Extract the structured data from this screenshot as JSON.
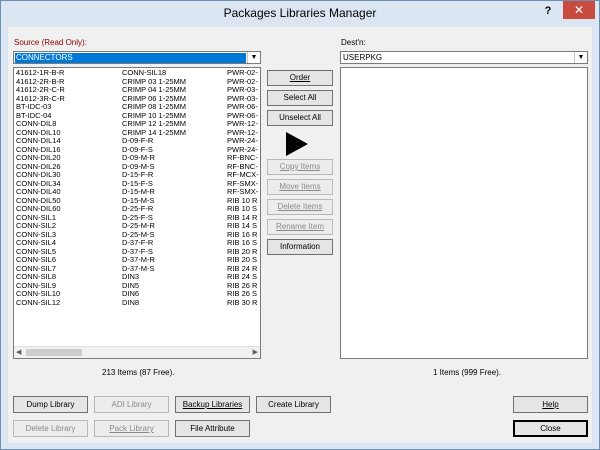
{
  "window": {
    "title": "Packages Libraries Manager",
    "help": "?",
    "close": "✕"
  },
  "source": {
    "label": "Source (Read Only):",
    "selected": "CONNECTORS"
  },
  "dest": {
    "label": "Dest'n:",
    "selected": "USERPKG"
  },
  "source_list": {
    "col1": [
      "41612-1R-B-R",
      "41612-2R-B-R",
      "41612-2R-C-R",
      "41612-3R-C-R",
      "BT-IDC-03",
      "BT-IDC-04",
      "CONN-DIL8",
      "CONN-DIL10",
      "CONN-DIL14",
      "CONN-DIL16",
      "CONN-DIL20",
      "CONN-DIL26",
      "CONN-DIL30",
      "CONN-DIL34",
      "CONN-DIL40",
      "CONN-DIL50",
      "CONN-DIL60",
      "CONN-SIL1",
      "CONN-SIL2",
      "CONN-SIL3",
      "CONN-SIL4",
      "CONN-SIL5",
      "CONN-SIL6",
      "CONN-SIL7",
      "CONN-SIL8",
      "CONN-SIL9",
      "CONN-SIL10",
      "CONN-SIL12"
    ],
    "col2": [
      "CONN-SIL18",
      "CRIMP 03 1-25MM",
      "CRIMP 04 1-25MM",
      "CRIMP 06 1-25MM",
      "CRIMP 08 1-25MM",
      "CRIMP 10 1-25MM",
      "CRIMP 12 1-25MM",
      "CRIMP 14 1-25MM",
      "D-09-F-R",
      "D-09-F-S",
      "D-09-M-R",
      "D-09-M-S",
      "D-15-F-R",
      "D-15-F-S",
      "D-15-M-R",
      "D-15-M-S",
      "D-25-F-R",
      "D-25-F-S",
      "D-25-M-R",
      "D-25-M-S",
      "D-37-F-R",
      "D-37-F-S",
      "D-37-M-R",
      "D-37-M-S",
      "DIN3",
      "DIN5",
      "DIN6",
      "DIN8"
    ],
    "col3": [
      "PWR-02-",
      "PWR-02-",
      "PWR-03-",
      "PWR-03-",
      "PWR-06-",
      "PWR-06-",
      "PWR-12-",
      "PWR-12-",
      "PWR-24-",
      "PWR-24-",
      "RF-BNC-",
      "RF-BNC-",
      "RF-MCX-",
      "RF-SMX-",
      "RF-SMX-",
      "RIB 10 R",
      "RIB 10 S",
      "RIB 14 R",
      "RIB 14 S",
      "RIB 16 R",
      "RIB 16 S",
      "RIB 20 R",
      "RIB 20 S",
      "RIB 24 R",
      "RIB 24 S",
      "RIB 26 R",
      "RIB 26 S",
      "RIB 30 R"
    ],
    "status": "213 Items (87 Free)."
  },
  "dest_list": {
    "status": "1 Items (999 Free)."
  },
  "mid_buttons": {
    "order": "Order",
    "select_all": "Select All",
    "unselect_all": "Unselect All",
    "copy_items": "Copy Items",
    "move_items": "Move Items",
    "delete_items": "Delete Items",
    "rename_item": "Rename Item",
    "information": "Information"
  },
  "bottom_buttons": {
    "dump_library": "Dump Library",
    "adi_library": "ADI Library",
    "backup_libraries": "Backup Libraries",
    "create_library": "Create Library",
    "delete_library": "Delete Library",
    "pack_library": "Pack Library",
    "file_attribute": "File Attribute",
    "help": "Help",
    "close": "Close"
  }
}
